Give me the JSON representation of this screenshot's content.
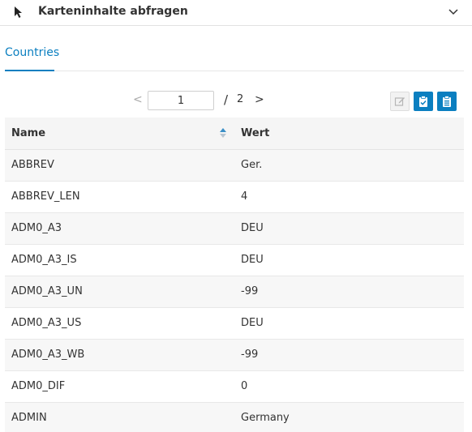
{
  "header": {
    "title": "Karteninhalte abfragen"
  },
  "tabs": [
    {
      "label": "Countries"
    }
  ],
  "pager": {
    "prev": "<",
    "current_page": "1",
    "separator": "/",
    "total_pages": "2",
    "next": ">"
  },
  "table": {
    "columns": [
      "Name",
      "Wert"
    ],
    "rows": [
      {
        "name": "ABBREV",
        "value": "Ger."
      },
      {
        "name": "ABBREV_LEN",
        "value": "4"
      },
      {
        "name": "ADM0_A3",
        "value": "DEU"
      },
      {
        "name": "ADM0_A3_IS",
        "value": "DEU"
      },
      {
        "name": "ADM0_A3_UN",
        "value": "-99"
      },
      {
        "name": "ADM0_A3_US",
        "value": "DEU"
      },
      {
        "name": "ADM0_A3_WB",
        "value": "-99"
      },
      {
        "name": "ADM0_DIF",
        "value": "0"
      },
      {
        "name": "ADMIN",
        "value": "Germany"
      }
    ]
  },
  "colors": {
    "accent": "#0b7fc0",
    "row_alt": "#f7f7f7"
  },
  "icons": {
    "header": "cursor-pointer-icon",
    "collapse": "chevron-down-icon",
    "edit": "edit-icon",
    "copy_one": "clipboard-check-icon",
    "copy_all": "clipboard-list-icon",
    "sort": "sort-icon"
  }
}
